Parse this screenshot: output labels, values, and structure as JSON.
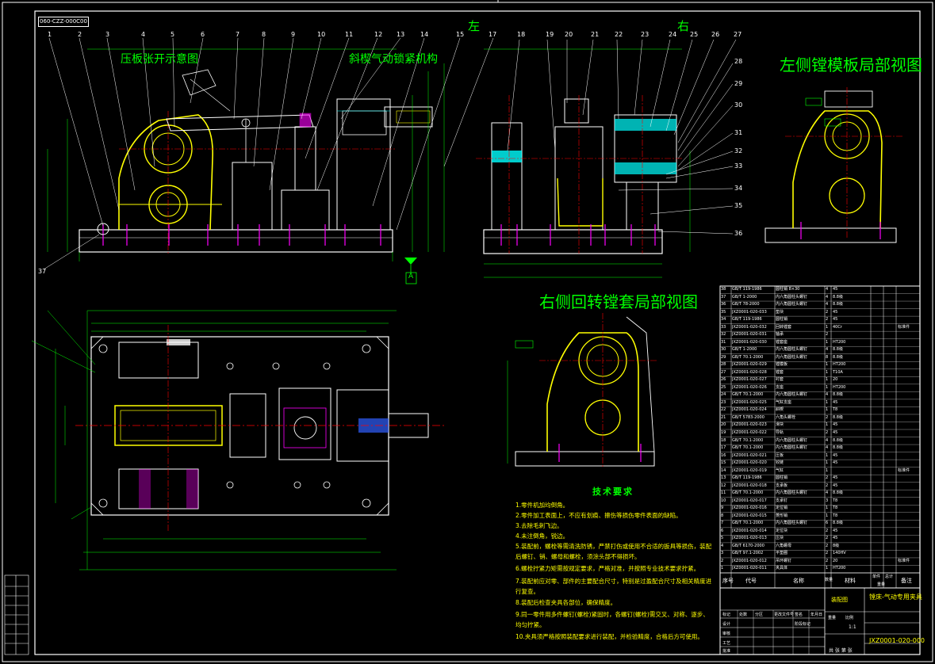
{
  "drawing_number": "060-CZZ-000C00",
  "view_titles": {
    "clamp_open": "压板张开示意图",
    "pneumatic_clamp": "斜楔气动锁紧机构",
    "left_boring": "左侧镗模板局部视图",
    "right_boring": "右侧回转镗套局部视图"
  },
  "side_labels": {
    "left": "左",
    "right": "右"
  },
  "datum_label": "A",
  "tech_requirements": {
    "title": "技术要求",
    "notes": [
      "1.零件机加均倒角。",
      "2.零件加工表面上，不应有划痕、擦伤等损伤零件表面的缺陷。",
      "3.去除毛刺飞边。",
      "4.未注倒角，锐边。",
      "5.装配前，螺栓等需清洗防锈，严禁打伤或使用不合适的扳具等损伤，装配后螺钉、销、螺母和螺栓，须涂头部不得损坏。",
      "6.螺栓拧紧力矩需按规定要求，严格对准，并按照专业技术要求拧紧。",
      "7.装配前应对零、部件的主要配合尺寸，特别是过盈配合尺寸及相关精度进行复查。",
      "8.装配后检查夹具各部位，确保精度。",
      "9.同一零件用多件螺钉(螺栓)紧固时，各螺钉(螺栓)需交叉、对称、逐步、均匀拧紧。",
      "10.夹具须严格按照装配要求进行装配，并检验精度，合格后方可使用。"
    ]
  },
  "bom": {
    "headers": {
      "seq": "序号",
      "code": "代号",
      "name": "名称",
      "qty": "数量",
      "material": "材料",
      "single": "单件",
      "total": "总计",
      "weight": "重量",
      "remark": "备注"
    },
    "rows": [
      [
        "38",
        "GB/T 119-1986",
        "圆柱销 8×30",
        "4",
        "45",
        "",
        ""
      ],
      [
        "37",
        "GB/T 1-2000",
        "内六角圆柱头螺钉",
        "4",
        "8.8级",
        "",
        ""
      ],
      [
        "36",
        "GB/T 78-2000",
        "内六角圆柱头螺钉",
        "4",
        "8.8级",
        "",
        ""
      ],
      [
        "35",
        "JXZ0001-020-033",
        "垫块",
        "2",
        "45",
        "",
        ""
      ],
      [
        "34",
        "GB/T 119-1986",
        "圆柱销",
        "2",
        "45",
        "",
        ""
      ],
      [
        "33",
        "JXZ0001-020-032",
        "回转镗套",
        "1",
        "40Cr",
        "",
        "标准件"
      ],
      [
        "32",
        "JXZ0001-020-031",
        "轴承",
        "2",
        "",
        "",
        ""
      ],
      [
        "31",
        "JXZ0001-020-030",
        "镗套座",
        "1",
        "HT200",
        "",
        ""
      ],
      [
        "30",
        "GB/T 1-2000",
        "内六角圆柱头螺钉",
        "4",
        "8.8级",
        "",
        ""
      ],
      [
        "29",
        "GB/T 70.1-2000",
        "内六角圆柱头螺钉",
        "8",
        "8.8级",
        "",
        ""
      ],
      [
        "28",
        "JXZ0001-020-029",
        "镗模板",
        "1",
        "HT200",
        "",
        ""
      ],
      [
        "27",
        "JXZ0001-020-028",
        "镗套",
        "1",
        "T10A",
        "",
        ""
      ],
      [
        "26",
        "JXZ0001-020-027",
        "衬套",
        "1",
        "20",
        "",
        ""
      ],
      [
        "25",
        "JXZ0001-020-026",
        "支座",
        "1",
        "HT200",
        "",
        ""
      ],
      [
        "24",
        "GB/T 70.1-2000",
        "内六角圆柱头螺钉",
        "4",
        "8.8级",
        "",
        ""
      ],
      [
        "23",
        "JXZ0001-020-025",
        "气缸支座",
        "1",
        "45",
        "",
        ""
      ],
      [
        "22",
        "JXZ0001-020-024",
        "斜楔",
        "1",
        "T8",
        "",
        ""
      ],
      [
        "21",
        "GB/T 5783-2000",
        "六角头螺栓",
        "2",
        "8.8级",
        "",
        ""
      ],
      [
        "20",
        "JXZ0001-020-023",
        "滑块",
        "1",
        "45",
        "",
        ""
      ],
      [
        "19",
        "JXZ0001-020-022",
        "导轨",
        "2",
        "45",
        "",
        ""
      ],
      [
        "18",
        "GB/T 70.1-2000",
        "内六角圆柱头螺钉",
        "4",
        "8.8级",
        "",
        ""
      ],
      [
        "17",
        "GB/T 70.1-2000",
        "内六角圆柱头螺钉",
        "4",
        "8.8级",
        "",
        ""
      ],
      [
        "16",
        "JXZ0001-020-021",
        "压板",
        "1",
        "45",
        "",
        ""
      ],
      [
        "15",
        "JXZ0001-020-020",
        "铰链",
        "1",
        "45",
        "",
        ""
      ],
      [
        "14",
        "JXZ0001-020-019",
        "气缸",
        "1",
        "",
        "",
        "标准件"
      ],
      [
        "13",
        "GB/T 119-1986",
        "圆柱销",
        "2",
        "45",
        "",
        ""
      ],
      [
        "12",
        "JXZ0001-020-018",
        "支承板",
        "2",
        "45",
        "",
        ""
      ],
      [
        "11",
        "GB/T 70.1-2000",
        "内六角圆柱头螺钉",
        "4",
        "8.8级",
        "",
        ""
      ],
      [
        "10",
        "JXZ0001-020-017",
        "支承钉",
        "3",
        "T8",
        "",
        ""
      ],
      [
        "9",
        "JXZ0001-020-016",
        "定位销",
        "1",
        "T8",
        "",
        ""
      ],
      [
        "8",
        "JXZ0001-020-015",
        "菱形销",
        "1",
        "T8",
        "",
        ""
      ],
      [
        "7",
        "GB/T 70.1-2000",
        "内六角圆柱头螺钉",
        "6",
        "8.8级",
        "",
        ""
      ],
      [
        "6",
        "JXZ0001-020-014",
        "定位块",
        "2",
        "45",
        "",
        ""
      ],
      [
        "5",
        "JXZ0001-020-013",
        "压块",
        "2",
        "45",
        "",
        ""
      ],
      [
        "4",
        "GB/T 6170-2000",
        "六角螺母",
        "2",
        "8级",
        "",
        ""
      ],
      [
        "3",
        "GB/T 97.1-2002",
        "平垫圈",
        "2",
        "140HV",
        "",
        ""
      ],
      [
        "2",
        "JXZ0001-020-012",
        "吊环螺钉",
        "2",
        "20",
        "",
        "标准件"
      ],
      [
        "1",
        "JXZ0001-020-011",
        "夹具体",
        "1",
        "HT200",
        "",
        ""
      ]
    ]
  },
  "title_block": {
    "assembly": "装配图",
    "name": "镗床-气动专用夹具",
    "drawing_code": "JXZ0001-020-000",
    "scale": "1:1",
    "sheet": "共 张 第 张",
    "labels": [
      "设计",
      "审核",
      "工艺",
      "批准",
      "标记",
      "处数",
      "分区",
      "更改文件号",
      "签名",
      "年月日",
      "阶段标记",
      "重量",
      "比例"
    ]
  },
  "colors": {
    "outline": "#ffffff",
    "part": "#ffff00",
    "dim": "#00ff00",
    "center": "#ff0000",
    "accent": "#00ffff",
    "hatch": "#ff00ff",
    "fill_blue": "#3060ff"
  }
}
